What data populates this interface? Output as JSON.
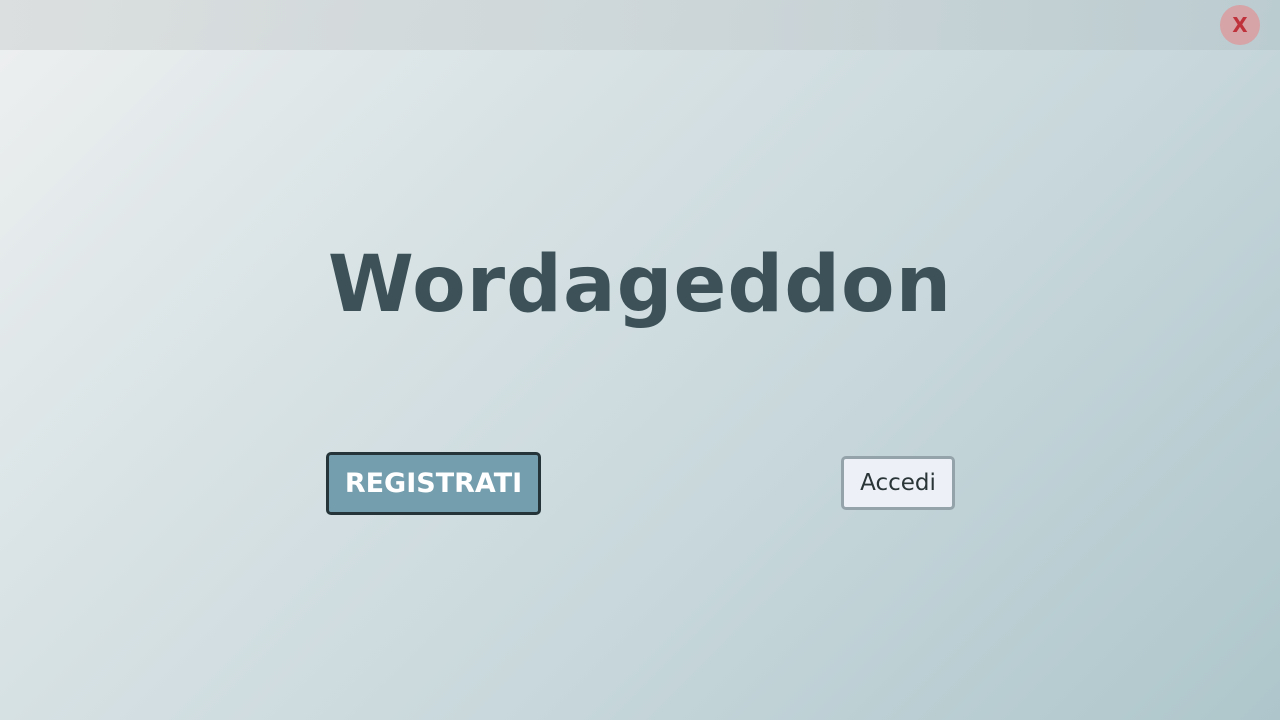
{
  "window": {
    "close_label": "X"
  },
  "main": {
    "title": "Wordageddon",
    "register_label": "REGISTRATI",
    "login_label": "Accedi"
  },
  "colors": {
    "title": "#3c5258",
    "register_bg": "#749ead",
    "register_border": "#243439",
    "login_bg": "#edf1f7",
    "close_bg": "#d6a3a6",
    "close_text": "#c0323b"
  }
}
